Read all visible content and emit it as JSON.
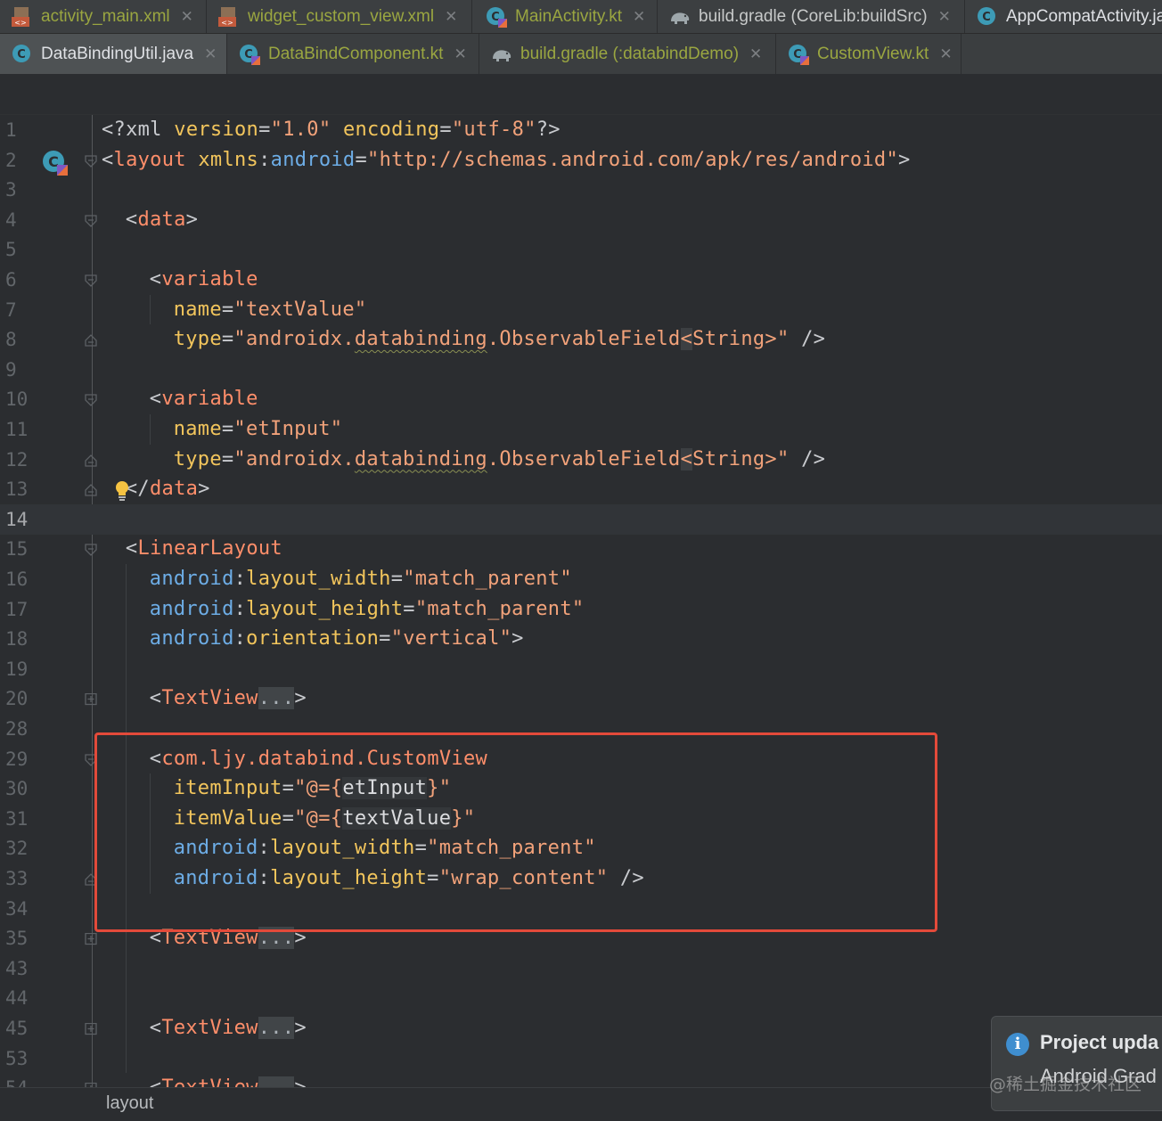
{
  "tabs_row1": [
    {
      "label": "activity_main.xml",
      "kind": "xml",
      "icon": "xml-file-icon",
      "active": false
    },
    {
      "label": "widget_custom_view.xml",
      "kind": "xml",
      "icon": "xml-file-icon",
      "active": false
    },
    {
      "label": "MainActivity.kt",
      "kind": "kt",
      "icon": "kotlin-class-icon",
      "active": false
    },
    {
      "label": "build.gradle (CoreLib:buildSrc)",
      "kind": "gradle",
      "icon": "gradle-elephant-icon",
      "active": false
    },
    {
      "label": "AppCompatActivity.ja",
      "kind": "java",
      "icon": "java-class-icon",
      "active": false
    }
  ],
  "tabs_row2": [
    {
      "label": "DataBindingUtil.java",
      "kind": "java",
      "icon": "java-class-icon",
      "active": true
    },
    {
      "label": "DataBindComponent.kt",
      "kind": "kt",
      "icon": "kotlin-class-icon",
      "active": false
    },
    {
      "label": "build.gradle (:databindDemo)",
      "kind": "gradle2",
      "icon": "gradle-elephant-icon",
      "active": false
    },
    {
      "label": "CustomView.kt",
      "kind": "kt",
      "icon": "kotlin-class-icon",
      "active": false
    }
  ],
  "editor": {
    "caret_line": "14",
    "lines": [
      {
        "n": "1",
        "fold": "",
        "indent": 0,
        "tokens": [
          [
            "p",
            "<?xml "
          ],
          [
            "a",
            "version"
          ],
          [
            "p",
            "="
          ],
          [
            "v",
            "\"1.0\""
          ],
          [
            "p",
            " "
          ],
          [
            "a",
            "encoding"
          ],
          [
            "p",
            "="
          ],
          [
            "v",
            "\"utf-8\""
          ],
          [
            "p",
            "?>"
          ]
        ]
      },
      {
        "n": "2",
        "fold": "open",
        "indent": 0,
        "tokens": [
          [
            "p",
            "<"
          ],
          [
            "t",
            "layout"
          ],
          [
            "p",
            " "
          ],
          [
            "a",
            "xmlns"
          ],
          [
            "p",
            ":"
          ],
          [
            "ns",
            "android"
          ],
          [
            "p",
            "="
          ],
          [
            "v",
            "\"http://schemas.android.com/apk/res/android\""
          ],
          [
            "p",
            ">"
          ]
        ]
      },
      {
        "n": "3",
        "fold": "",
        "indent": 0,
        "tokens": []
      },
      {
        "n": "4",
        "fold": "open",
        "indent": 1,
        "tokens": [
          [
            "p",
            "<"
          ],
          [
            "t",
            "data"
          ],
          [
            "p",
            ">"
          ]
        ]
      },
      {
        "n": "5",
        "fold": "",
        "indent": 0,
        "tokens": []
      },
      {
        "n": "6",
        "fold": "open",
        "indent": 2,
        "tokens": [
          [
            "p",
            "<"
          ],
          [
            "t",
            "variable"
          ]
        ]
      },
      {
        "n": "7",
        "fold": "",
        "indent": 3,
        "tokens": [
          [
            "a",
            "name"
          ],
          [
            "p",
            "="
          ],
          [
            "v",
            "\"textValue\""
          ]
        ]
      },
      {
        "n": "8",
        "fold": "close",
        "indent": 3,
        "tokens": [
          [
            "a",
            "type"
          ],
          [
            "p",
            "="
          ],
          [
            "v",
            "\"androidx."
          ],
          [
            "vsq",
            "databinding"
          ],
          [
            "v",
            "."
          ],
          [
            "v",
            "ObservableField"
          ],
          [
            "vhl",
            "<"
          ],
          [
            "v",
            "String>\""
          ],
          [
            "p",
            " />"
          ]
        ]
      },
      {
        "n": "9",
        "fold": "",
        "indent": 0,
        "tokens": []
      },
      {
        "n": "10",
        "fold": "open",
        "indent": 2,
        "tokens": [
          [
            "p",
            "<"
          ],
          [
            "t",
            "variable"
          ]
        ]
      },
      {
        "n": "11",
        "fold": "",
        "indent": 3,
        "tokens": [
          [
            "a",
            "name"
          ],
          [
            "p",
            "="
          ],
          [
            "v",
            "\"etInput\""
          ]
        ]
      },
      {
        "n": "12",
        "fold": "close",
        "indent": 3,
        "tokens": [
          [
            "a",
            "type"
          ],
          [
            "p",
            "="
          ],
          [
            "v",
            "\"androidx."
          ],
          [
            "vsq",
            "databinding"
          ],
          [
            "v",
            "."
          ],
          [
            "v",
            "ObservableField"
          ],
          [
            "vhl",
            "<"
          ],
          [
            "v",
            "String>\""
          ],
          [
            "p",
            " />"
          ]
        ]
      },
      {
        "n": "13",
        "fold": "close",
        "indent": 1,
        "tokens": [
          [
            "p",
            "</"
          ],
          [
            "t",
            "data"
          ],
          [
            "p",
            ">"
          ]
        ]
      },
      {
        "n": "14",
        "fold": "",
        "indent": 0,
        "tokens": []
      },
      {
        "n": "15",
        "fold": "open",
        "indent": 1,
        "tokens": [
          [
            "p",
            "<"
          ],
          [
            "t",
            "LinearLayout"
          ]
        ]
      },
      {
        "n": "16",
        "fold": "",
        "indent": 2,
        "tokens": [
          [
            "ns",
            "android"
          ],
          [
            "p",
            ":"
          ],
          [
            "a",
            "layout_width"
          ],
          [
            "p",
            "="
          ],
          [
            "v",
            "\"match_parent\""
          ]
        ]
      },
      {
        "n": "17",
        "fold": "",
        "indent": 2,
        "tokens": [
          [
            "ns",
            "android"
          ],
          [
            "p",
            ":"
          ],
          [
            "a",
            "layout_height"
          ],
          [
            "p",
            "="
          ],
          [
            "v",
            "\"match_parent\""
          ]
        ]
      },
      {
        "n": "18",
        "fold": "",
        "indent": 2,
        "tokens": [
          [
            "ns",
            "android"
          ],
          [
            "p",
            ":"
          ],
          [
            "a",
            "orientation"
          ],
          [
            "p",
            "="
          ],
          [
            "v",
            "\"vertical\""
          ],
          [
            "p",
            ">"
          ]
        ]
      },
      {
        "n": "19",
        "fold": "",
        "indent": 0,
        "tokens": []
      },
      {
        "n": "20",
        "fold": "plus",
        "indent": 2,
        "tokens": [
          [
            "p",
            "<"
          ],
          [
            "t",
            "TextView"
          ],
          [
            "ph",
            "..."
          ],
          [
            "p",
            ">"
          ]
        ]
      },
      {
        "n": "28",
        "fold": "",
        "indent": 0,
        "tokens": []
      },
      {
        "n": "29",
        "fold": "open",
        "indent": 2,
        "tokens": [
          [
            "p",
            "<"
          ],
          [
            "t",
            "com.ljy.databind.CustomView"
          ]
        ]
      },
      {
        "n": "30",
        "fold": "",
        "indent": 3,
        "tokens": [
          [
            "a",
            "itemInput"
          ],
          [
            "p",
            "="
          ],
          [
            "v",
            "\"@={"
          ],
          [
            "ex",
            "etInput"
          ],
          [
            "v",
            "}\""
          ]
        ]
      },
      {
        "n": "31",
        "fold": "",
        "indent": 3,
        "tokens": [
          [
            "a",
            "itemValue"
          ],
          [
            "p",
            "="
          ],
          [
            "v",
            "\"@={"
          ],
          [
            "ex",
            "textValue"
          ],
          [
            "v",
            "}\""
          ]
        ]
      },
      {
        "n": "32",
        "fold": "",
        "indent": 3,
        "tokens": [
          [
            "ns",
            "android"
          ],
          [
            "p",
            ":"
          ],
          [
            "a",
            "layout_width"
          ],
          [
            "p",
            "="
          ],
          [
            "v",
            "\"match_parent\""
          ]
        ]
      },
      {
        "n": "33",
        "fold": "close",
        "indent": 3,
        "tokens": [
          [
            "ns",
            "android"
          ],
          [
            "p",
            ":"
          ],
          [
            "a",
            "layout_height"
          ],
          [
            "p",
            "="
          ],
          [
            "v",
            "\"wrap_content\""
          ],
          [
            "p",
            " />"
          ]
        ]
      },
      {
        "n": "34",
        "fold": "",
        "indent": 0,
        "tokens": []
      },
      {
        "n": "35",
        "fold": "plus",
        "indent": 2,
        "tokens": [
          [
            "p",
            "<"
          ],
          [
            "t",
            "TextView"
          ],
          [
            "ph",
            "..."
          ],
          [
            "p",
            ">"
          ]
        ]
      },
      {
        "n": "43",
        "fold": "",
        "indent": 0,
        "tokens": []
      },
      {
        "n": "44",
        "fold": "",
        "indent": 0,
        "tokens": []
      },
      {
        "n": "45",
        "fold": "plus",
        "indent": 2,
        "tokens": [
          [
            "p",
            "<"
          ],
          [
            "t",
            "TextView"
          ],
          [
            "ph",
            "..."
          ],
          [
            "p",
            ">"
          ]
        ]
      },
      {
        "n": "53",
        "fold": "",
        "indent": 0,
        "tokens": []
      },
      {
        "n": "54",
        "fold": "plus",
        "indent": 2,
        "tokens": [
          [
            "p",
            "<"
          ],
          [
            "t",
            "TextView"
          ],
          [
            "ph",
            "..."
          ],
          [
            "p",
            ">"
          ]
        ]
      }
    ]
  },
  "statusbar": {
    "breadcrumb": "layout"
  },
  "notification": {
    "title": "Project upda",
    "body": "Android Grad"
  },
  "watermark": "@稀土掘金技术社区",
  "colors": {
    "tag": "#fe8e6a",
    "attribute": "#f2c55c",
    "value": "#f2a27a",
    "namespace": "#6dade6",
    "highlight_box": "#e34a3a"
  }
}
